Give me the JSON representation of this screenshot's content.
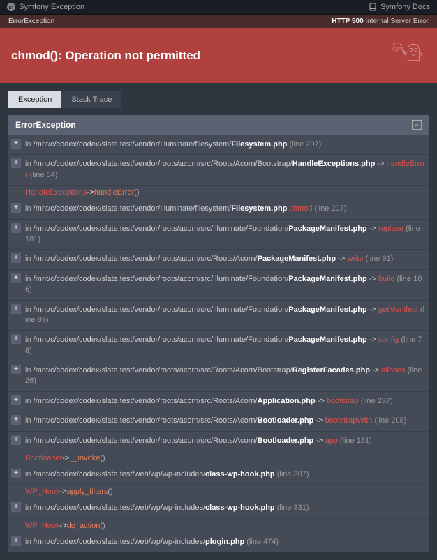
{
  "topbar": {
    "brand": "Symfony Exception",
    "docs": "Symfony Docs"
  },
  "status": {
    "exception_class": "ErrorException",
    "http_label": "HTTP 500",
    "http_text": "Internal Server Error"
  },
  "banner": {
    "message": "chmod(): Operation not permitted"
  },
  "tabs": {
    "exception": "Exception",
    "stack_trace": "Stack Trace"
  },
  "panel": {
    "title": "ErrorException"
  },
  "strings": {
    "in": "in",
    "arrow": "->",
    "open_paren": "(",
    "close_paren": ")"
  },
  "traces": [
    {
      "type": "file",
      "path": "/mnt/c/codex/codex/slate.test/vendor/Illuminate/filesystem/",
      "file": "Filesystem.php",
      "line": "(line 207)"
    },
    {
      "type": "file",
      "path": "/mnt/c/codex/codex/slate.test/vendor/roots/acorn/src/Roots/Acorn/Bootstrap/",
      "file": "HandleExceptions.php",
      "method": "handleError",
      "line": "(line 54)"
    },
    {
      "type": "call",
      "cls": "HandleExceptions",
      "mth": "handleError"
    },
    {
      "type": "file",
      "path": "/mnt/c/codex/codex/slate.test/vendor/Illuminate/filesystem/",
      "file": "Filesystem.php",
      "method_plain": ".chmod",
      "line": "(line 207)"
    },
    {
      "type": "file",
      "path": "/mnt/c/codex/codex/slate.test/vendor/roots/acorn/src/Illuminate/Foundation/",
      "file": "PackageManifest.php",
      "method": "replace",
      "line": "(line 181)"
    },
    {
      "type": "file",
      "path": "/mnt/c/codex/codex/slate.test/vendor/roots/acorn/src/Roots/Acorn/",
      "file": "PackageManifest.php",
      "method": "write",
      "line": "(line 91)"
    },
    {
      "type": "file",
      "path": "/mnt/c/codex/codex/slate.test/vendor/roots/acorn/src/Illuminate/Foundation/",
      "file": "PackageManifest.php",
      "method": "build",
      "line": "(line 106)"
    },
    {
      "type": "file",
      "path": "/mnt/c/codex/codex/slate.test/vendor/roots/acorn/src/Illuminate/Foundation/",
      "file": "PackageManifest.php",
      "method": "getManifest",
      "line": "(line 89)"
    },
    {
      "type": "file",
      "path": "/mnt/c/codex/codex/slate.test/vendor/roots/acorn/src/Illuminate/Foundation/",
      "file": "PackageManifest.php",
      "method": "config",
      "line": "(line 78)"
    },
    {
      "type": "file",
      "path": "/mnt/c/codex/codex/slate.test/vendor/roots/acorn/src/Roots/Acorn/Bootstrap/",
      "file": "RegisterFacades.php",
      "method": "aliases",
      "line": "(line 26)"
    },
    {
      "type": "file",
      "path": "/mnt/c/codex/codex/slate.test/vendor/roots/acorn/src/Roots/Acorn/",
      "file": "Application.php",
      "method": "bootstrap",
      "line": "(line 237)"
    },
    {
      "type": "file",
      "path": "/mnt/c/codex/codex/slate.test/vendor/roots/acorn/src/Roots/Acorn/",
      "file": "Bootloader.php",
      "method": "bootstrapWith",
      "line": "(line 208)"
    },
    {
      "type": "file",
      "path": "/mnt/c/codex/codex/slate.test/vendor/roots/acorn/src/Roots/Acorn/",
      "file": "Bootloader.php",
      "method": "app",
      "line": "(line 181)"
    },
    {
      "type": "call",
      "cls": "Bootloader",
      "mth": "__invoke"
    },
    {
      "type": "file",
      "path": "/mnt/c/codex/codex/slate.test/web/wp/wp-includes/",
      "file": "class-wp-hook.php",
      "line": "(line 307)",
      "noborder": true
    },
    {
      "type": "call",
      "cls": "WP_Hook",
      "mth": "apply_filters",
      "sep": true
    },
    {
      "type": "file",
      "path": "/mnt/c/codex/codex/slate.test/web/wp/wp-includes/",
      "file": "class-wp-hook.php",
      "line": "(line 331)",
      "noborder": true
    },
    {
      "type": "call",
      "cls": "WP_Hook",
      "mth": "do_action",
      "sep": true
    },
    {
      "type": "file",
      "path": "/mnt/c/codex/codex/slate.test/web/wp/wp-includes/",
      "file": "plugin.php",
      "line": "(line 474)",
      "noborder": true
    }
  ]
}
